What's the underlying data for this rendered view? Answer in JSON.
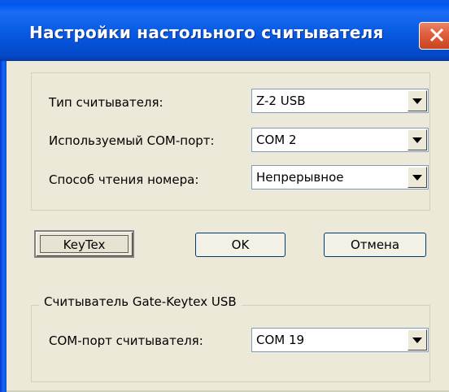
{
  "window": {
    "title": "Настройки настольного считывателя"
  },
  "reader_settings": {
    "reader_type_label": "Тип считывателя:",
    "reader_type_value": "Z-2 USB",
    "com_port_label": "Используемый COM-порт:",
    "com_port_value": "COM 2",
    "read_mode_label": "Способ чтения номера:",
    "read_mode_value": "Непрерывное"
  },
  "buttons": {
    "keytex": "KeyTex",
    "ok": "OK",
    "cancel": "Отмена"
  },
  "gate_keytex": {
    "group_label": "Считыватель Gate-Keytex USB",
    "com_port_label": "COM-порт считывателя:",
    "com_port_value": "COM 19"
  },
  "colors": {
    "titlebar": "#0058ee",
    "window_bg": "#ece9d8",
    "close_button": "#e0613e"
  },
  "icons": {
    "close": "close-icon",
    "dropdown": "chevron-down-icon"
  }
}
